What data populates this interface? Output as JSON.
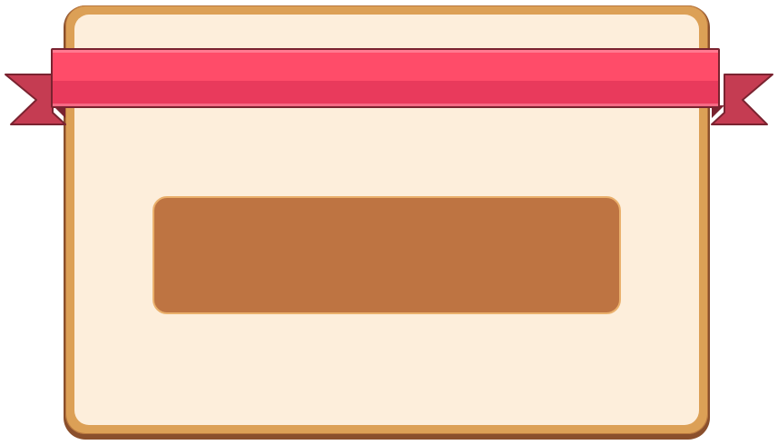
{
  "panel": {
    "ribbon_title": "",
    "slot_text": ""
  },
  "colors": {
    "frame": "#dca056",
    "frame_rim": "#8a4f2c",
    "panel_fill": "#fdeedb",
    "slot_fill": "#be7442",
    "slot_border": "#eab06c",
    "ribbon_top": "#ff4c69",
    "ribbon_bottom": "#e93a5c",
    "ribbon_tail": "#c53c52",
    "ribbon_outline": "#7a2330"
  }
}
